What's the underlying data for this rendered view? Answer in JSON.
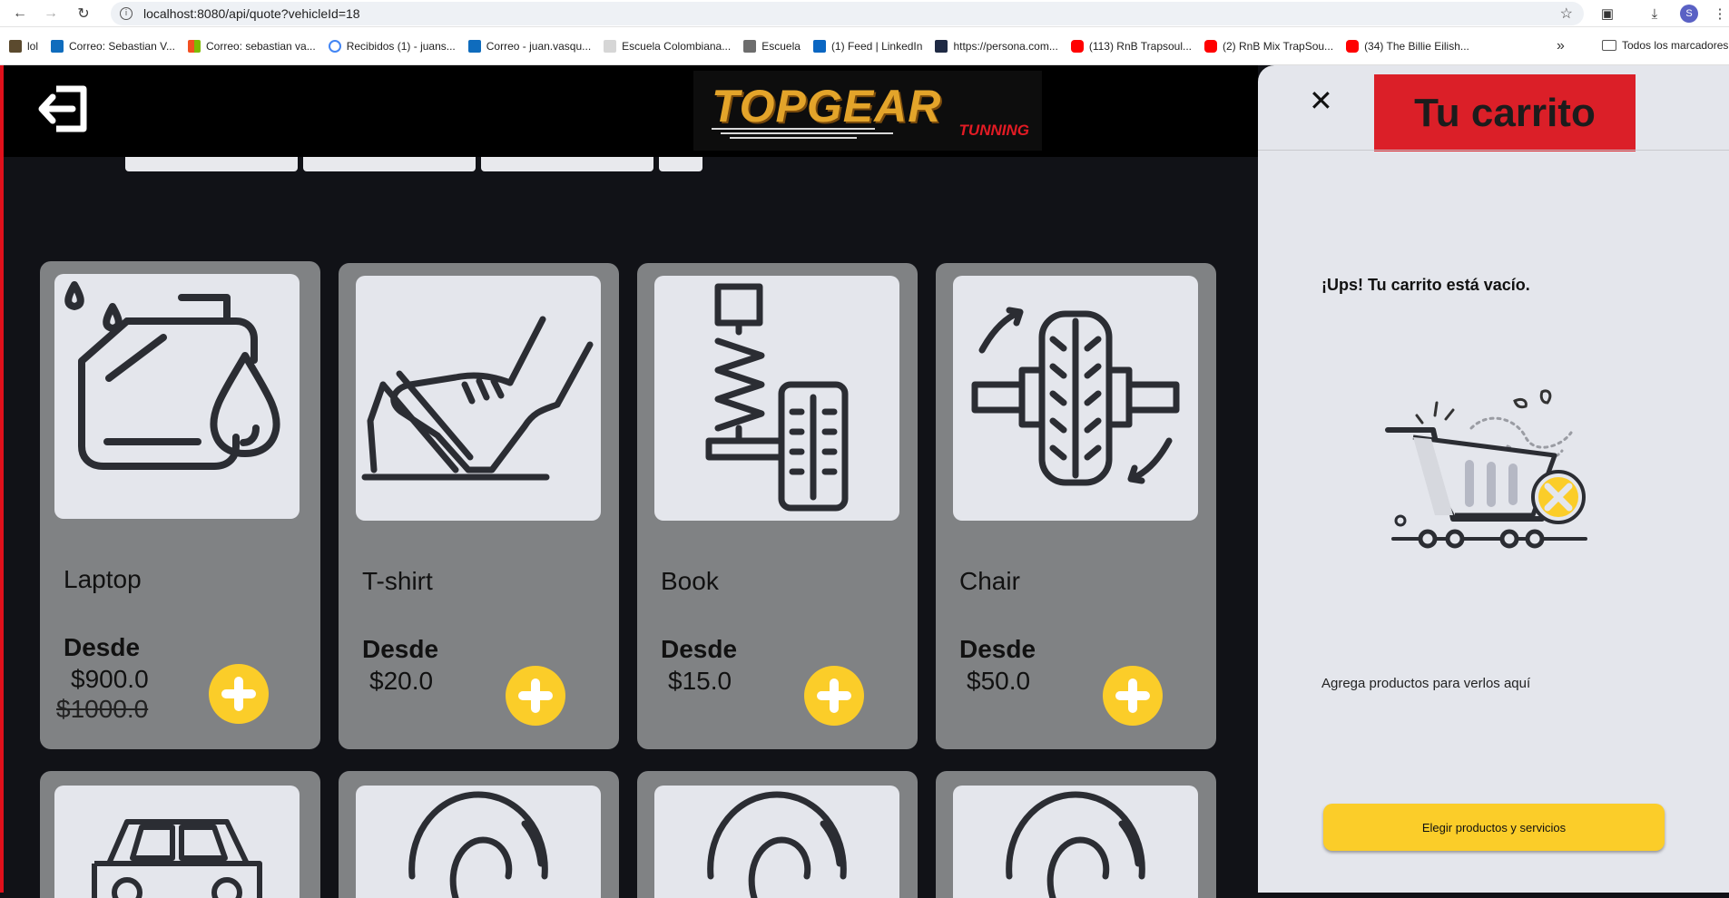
{
  "browser": {
    "url": "localhost:8080/api/quote?vehicleId=18",
    "profile_initial": "S",
    "bookmarks": [
      {
        "label": "lol",
        "color": "#5b4a2e"
      },
      {
        "label": "Correo: Sebastian V...",
        "color": "#0f6cbd"
      },
      {
        "label": "Correo: sebastian va...",
        "color": "#f25022"
      },
      {
        "label": "Recibidos (1) - juans...",
        "color": "#4285f4"
      },
      {
        "label": "Correo - juan.vasqu...",
        "color": "#0f6cbd"
      },
      {
        "label": "Escuela Colombiana...",
        "color": "#c9c9c9"
      },
      {
        "label": "Escuela",
        "color": "#6d6d6d"
      },
      {
        "label": "(1) Feed | LinkedIn",
        "color": "#0a66c2"
      },
      {
        "label": "https://persona.com...",
        "color": "#1f2a44"
      },
      {
        "label": "(113) RnB Trapsoul...",
        "color": "#ff0000"
      },
      {
        "label": "(2) RnB Mix TrapSou...",
        "color": "#ff0000"
      },
      {
        "label": "(34) The Billie Eilish...",
        "color": "#ff0000"
      }
    ],
    "bookmarks_folder": "Todos los marcadores"
  },
  "header": {
    "logo_main": "TOPGEAR",
    "logo_sub": "TUNNING"
  },
  "products": [
    {
      "name": "Laptop",
      "desde": "Desde",
      "price": "$900.0",
      "old_price": "$1000.0",
      "icon": "oil-can-icon"
    },
    {
      "name": "T-shirt",
      "desde": "Desde",
      "price": "$20.0",
      "old_price": "",
      "icon": "pedal-icon"
    },
    {
      "name": "Book",
      "desde": "Desde",
      "price": "$15.0",
      "old_price": "",
      "icon": "suspension-icon"
    },
    {
      "name": "Chair",
      "desde": "Desde",
      "price": "$50.0",
      "old_price": "",
      "icon": "wheel-alignment-icon"
    }
  ],
  "cart": {
    "title": "Tu carrito",
    "empty_message": "¡Ups! Tu carrito está vacío.",
    "hint": "Agrega productos para verlos aquí",
    "cta_label": "Elegir productos y servicios",
    "accent_color": "#db1f28",
    "button_color": "#fbcd29"
  }
}
